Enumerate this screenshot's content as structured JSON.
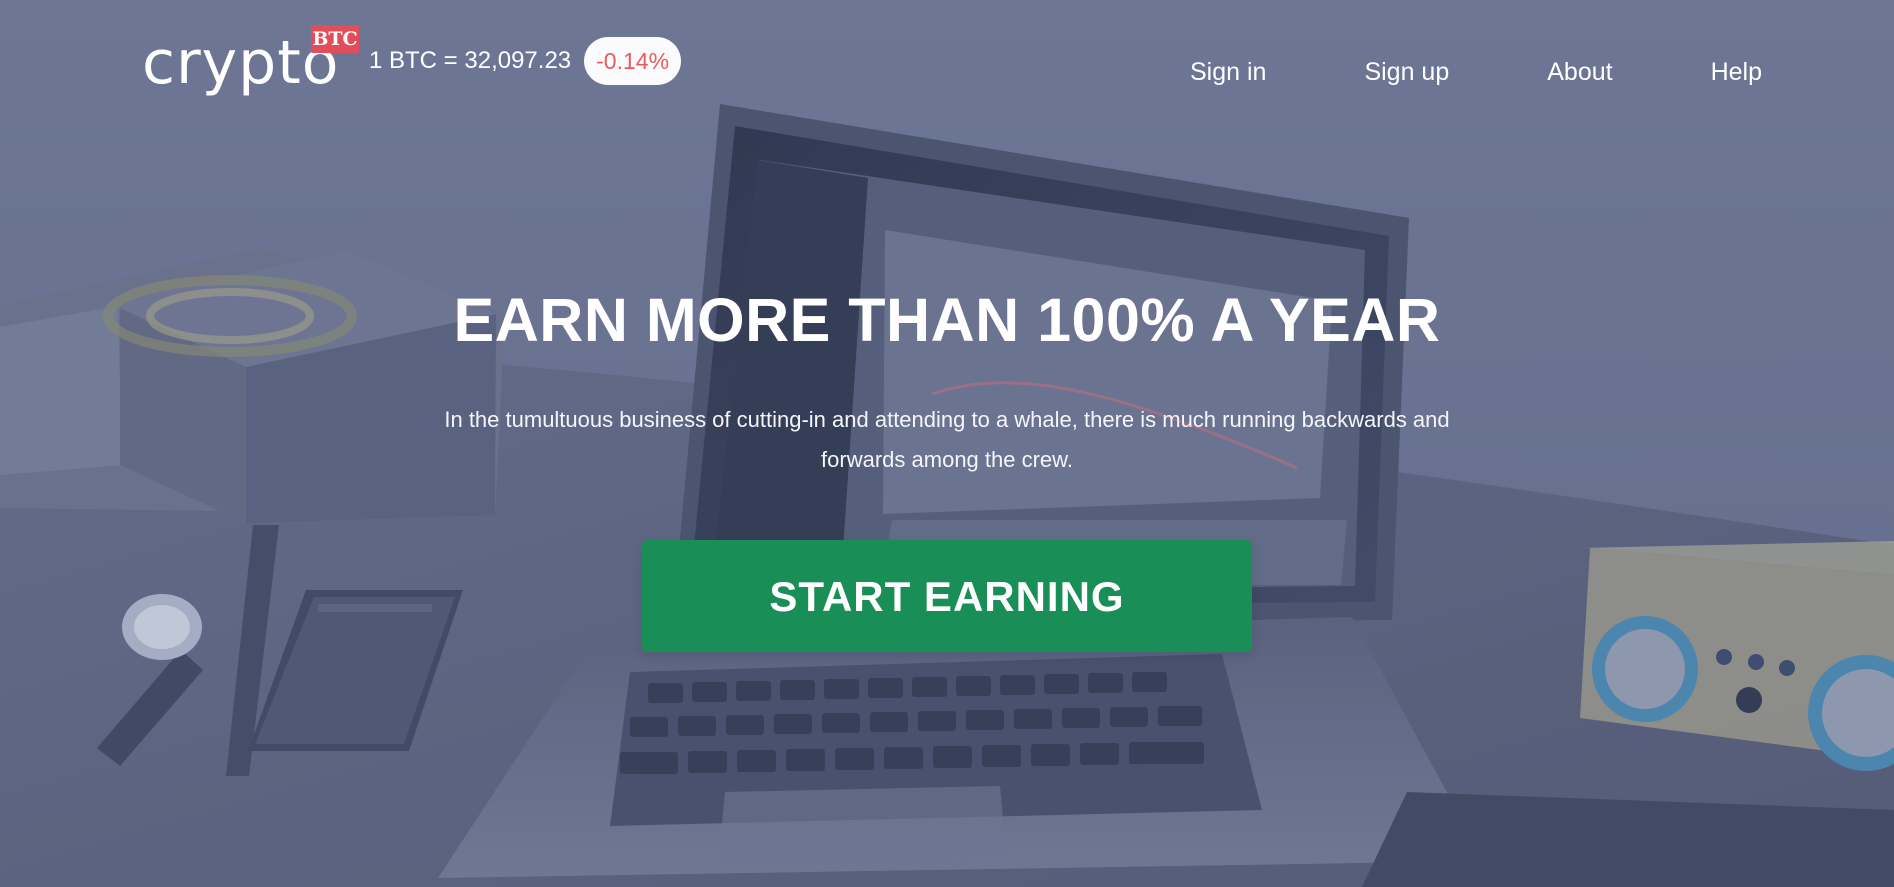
{
  "colors": {
    "overlay": "#666f8d",
    "accent_green": "#198e56",
    "badge_red": "#e34d5a",
    "change_red": "#e65c5c",
    "white": "#ffffff"
  },
  "header": {
    "logo": {
      "text": "crypto",
      "badge": "BTC"
    },
    "ticker": {
      "price": "1 BTC = 32,097.23",
      "change": "-0.14%"
    },
    "nav": [
      {
        "label": "Sign in"
      },
      {
        "label": "Sign up"
      },
      {
        "label": "About"
      },
      {
        "label": "Help"
      }
    ]
  },
  "hero": {
    "title": "EARN MORE THAN 100% A YEAR",
    "subtitle": "In the tumultuous business of cutting-in and attending to a whale, there is much running backwards and forwards among the crew.",
    "cta_label": "START EARNING"
  }
}
